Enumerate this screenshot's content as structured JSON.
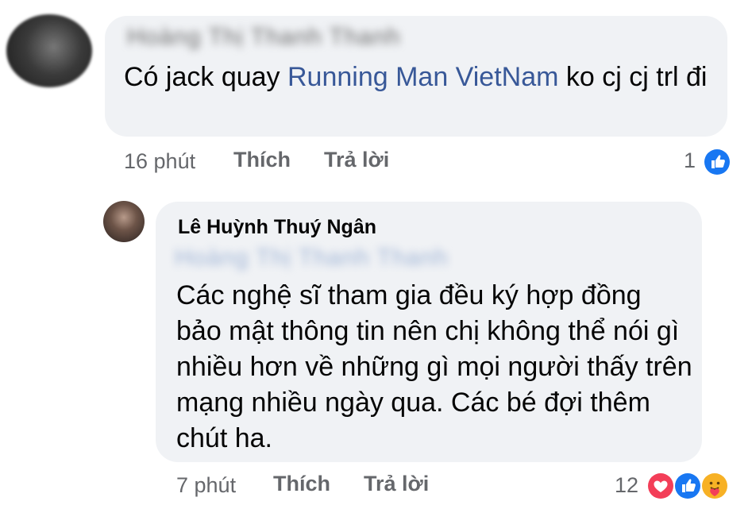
{
  "comment": {
    "author_blurred": "Hoàng Thị Thanh Thanh",
    "text_before": "Có jack quay ",
    "mention": "Running Man VietNam",
    "text_after": " ko cj cj trl đi",
    "time": "16 phút",
    "like_label": "Thích",
    "reply_label": "Trả lời",
    "reaction_count": "1",
    "reactions": [
      "like-icon"
    ]
  },
  "reply": {
    "author": "Lê Huỳnh Thuý Ngân",
    "tagged_blurred": "Hoàng Thị Thanh Thanh",
    "text": "Các nghệ sĩ tham gia đều ký hợp đồng bảo mật thông tin nên chị không thể nói gì nhiều hơn về những gì mọi người thấy trên mạng nhiều ngày qua. Các bé đợi thêm chút ha.",
    "time": "7 phút",
    "like_label": "Thích",
    "reply_label": "Trả lời",
    "reaction_count": "12",
    "reactions": [
      "love-icon",
      "like-icon",
      "care-icon"
    ]
  },
  "colors": {
    "bubble": "#f0f2f5",
    "mention": "#385898",
    "meta_text": "#65676b",
    "like_blue": "#1877f2",
    "love_red": "#f33e58",
    "care_yellow": "#f7b125"
  }
}
